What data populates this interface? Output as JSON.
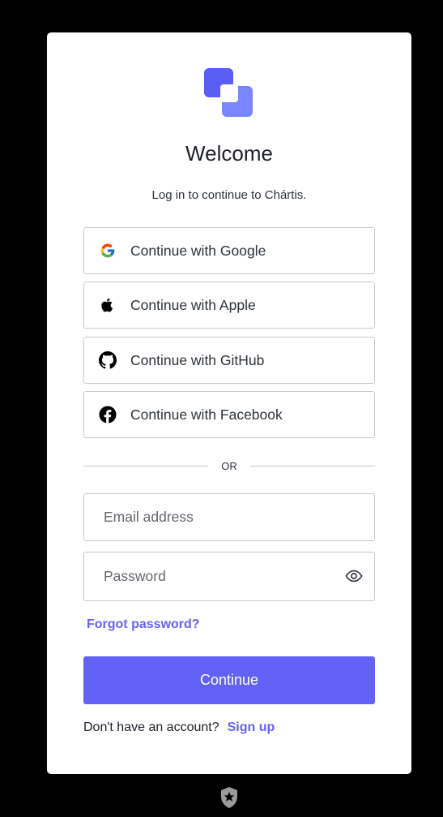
{
  "header": {
    "title": "Welcome",
    "subtitle": "Log in to continue to Chártis."
  },
  "social": [
    {
      "label": "Continue with Google",
      "icon": "google-icon"
    },
    {
      "label": "Continue with Apple",
      "icon": "apple-icon"
    },
    {
      "label": "Continue with GitHub",
      "icon": "github-icon"
    },
    {
      "label": "Continue with Facebook",
      "icon": "facebook-icon"
    }
  ],
  "divider_text": "OR",
  "form": {
    "email_placeholder": "Email address",
    "email_value": "",
    "password_placeholder": "Password",
    "password_value": "",
    "forgot_label": "Forgot password?",
    "submit_label": "Continue"
  },
  "signup": {
    "prompt": "Don't have an account?",
    "link": "Sign up"
  },
  "colors": {
    "accent": "#6362f7",
    "logo_light": "#7a86ff",
    "logo_dark": "#5a5ef5"
  }
}
